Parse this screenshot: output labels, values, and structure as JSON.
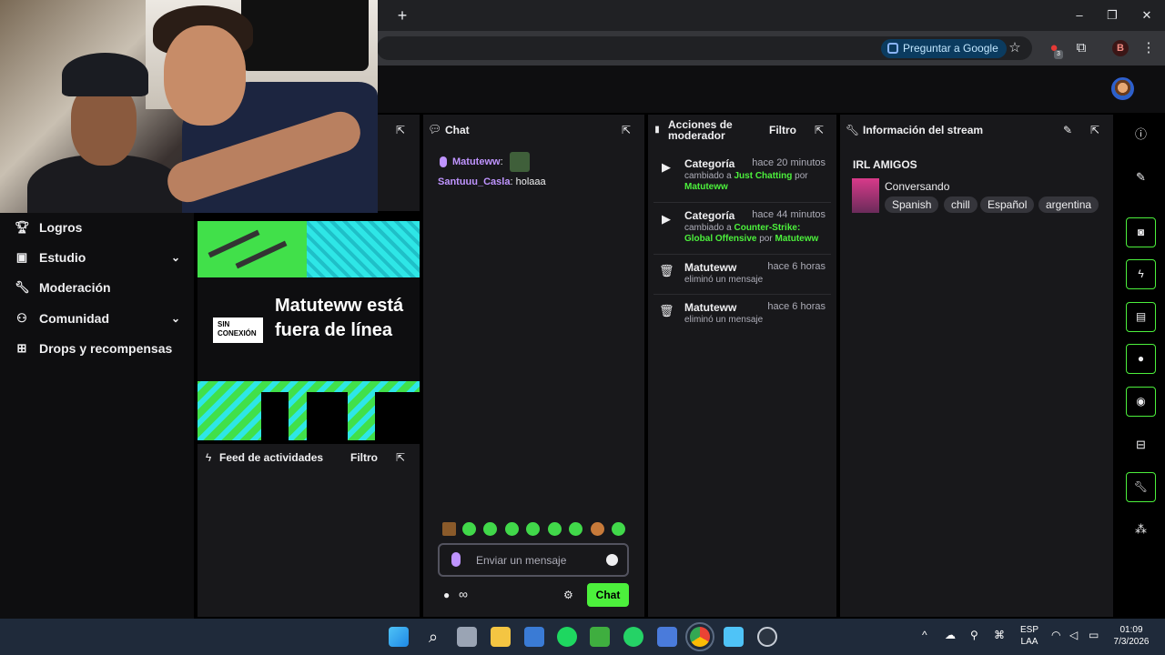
{
  "browser": {
    "new_tab": "+",
    "ask_google": "Preguntar a Google",
    "profile_initial": "B",
    "ext_badge": "3",
    "win_minimize": "–",
    "win_restore": "❐",
    "win_close": "✕"
  },
  "sidebar": {
    "items": [
      {
        "label": "Logros",
        "icon": "trophy-icon"
      },
      {
        "label": "Estudio",
        "icon": "studio-icon",
        "expandable": true
      },
      {
        "label": "Moderación",
        "icon": "wrench-icon"
      },
      {
        "label": "Comunidad",
        "icon": "community-icon",
        "expandable": true
      },
      {
        "label": "Drops y recompensas",
        "icon": "gift-icon"
      }
    ]
  },
  "preview": {
    "badge": "SIN CONEXIÓN",
    "offline_text": "Matuteww está fuera de línea"
  },
  "activity_feed": {
    "title": "Feed de actividades",
    "filter": "Filtro"
  },
  "chat": {
    "title": "Chat",
    "messages": [
      {
        "user": "Matuteww",
        "text": "",
        "user_color": "#bf94ff"
      },
      {
        "user": "Santuuu_Casla",
        "text": "holaaa",
        "user_color": "#bf94ff"
      }
    ],
    "placeholder": "Enviar un mensaje",
    "send_label": "Chat",
    "points": "∞"
  },
  "mod_actions": {
    "title": "Acciones de moderador",
    "filter": "Filtro",
    "entries": [
      {
        "title": "Categoría",
        "time": "hace 20 minutos",
        "pre": "cambiado a ",
        "highlight": "Just Chatting",
        "mid": " por ",
        "by": "Matuteww"
      },
      {
        "title": "Categoría",
        "time": "hace 44 minutos",
        "pre": "cambiado a ",
        "highlight": "Counter-Strike: Global Offensive",
        "mid": " por ",
        "by": "Matuteww"
      },
      {
        "title": "Matuteww",
        "time": "hace 6 horas",
        "desc": "eliminó un mensaje"
      },
      {
        "title": "Matuteww",
        "time": "hace 6 horas",
        "desc": "eliminó un mensaje"
      }
    ]
  },
  "stream_info": {
    "title": "Información del stream",
    "stream_title": "IRL AMIGOS",
    "category": "Conversando",
    "tags": [
      "Spanish",
      "chill",
      "Español",
      "argentina"
    ]
  },
  "taskbar": {
    "lang_top": "ESP",
    "lang_bottom": "LAA",
    "time": "01:09",
    "date": "7/3/2026"
  },
  "colors": {
    "accent_green": "#4cf03c",
    "accent_purple": "#bf94ff",
    "panel_bg": "#18181b"
  }
}
